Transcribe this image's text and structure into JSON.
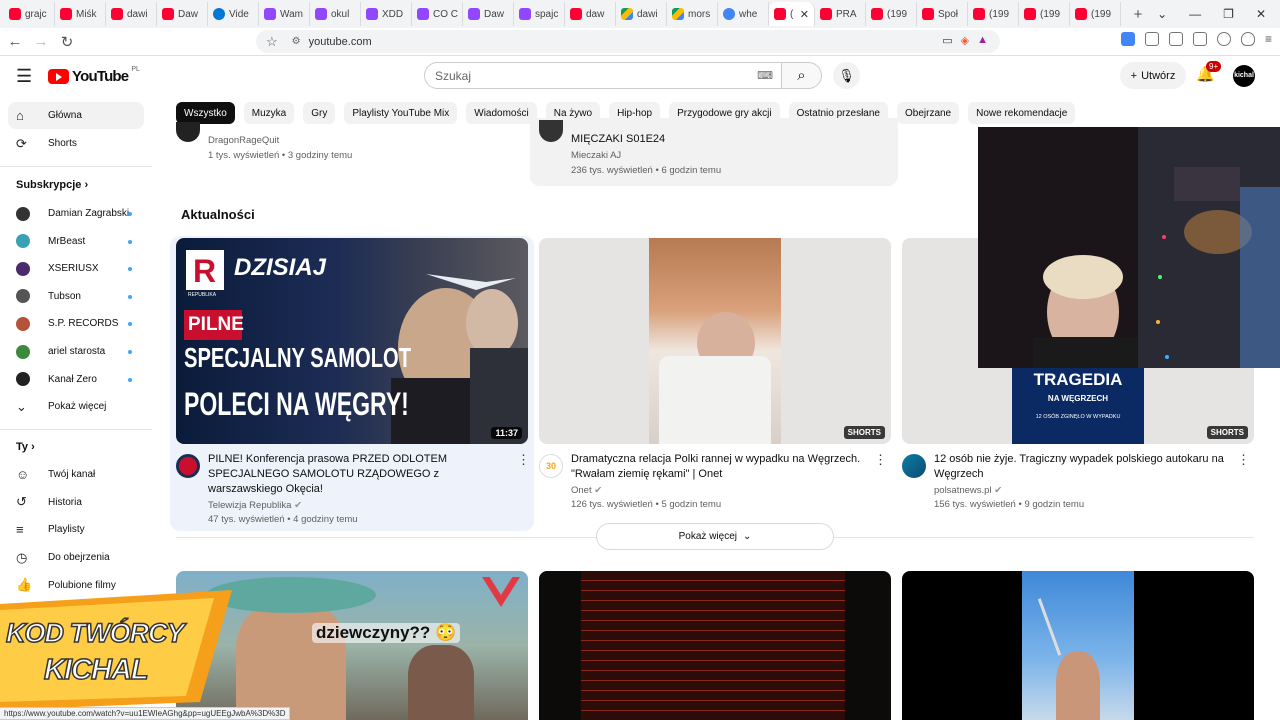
{
  "browser": {
    "tabs": [
      {
        "label": "grajc",
        "icon": "yt"
      },
      {
        "label": "Miśk",
        "icon": "yt"
      },
      {
        "label": "dawi",
        "icon": "yt"
      },
      {
        "label": "Daw",
        "icon": "yt"
      },
      {
        "label": "Vide",
        "icon": "ms"
      },
      {
        "label": "Wam",
        "icon": "tw"
      },
      {
        "label": "okul",
        "icon": "tw"
      },
      {
        "label": "XDD",
        "icon": "tw"
      },
      {
        "label": "CO C",
        "icon": "tw"
      },
      {
        "label": "Daw",
        "icon": "tw"
      },
      {
        "label": "spajc",
        "icon": "tw"
      },
      {
        "label": "daw",
        "icon": "yt"
      },
      {
        "label": "dawi",
        "icon": "gd"
      },
      {
        "label": "mors",
        "icon": "gd"
      },
      {
        "label": "whe",
        "icon": "go"
      },
      {
        "label": "(",
        "icon": "yt",
        "active": true
      },
      {
        "label": "PRA",
        "icon": "yt"
      },
      {
        "label": "(199",
        "icon": "yt"
      },
      {
        "label": "Społ",
        "icon": "yt"
      },
      {
        "label": "(199",
        "icon": "yt"
      },
      {
        "label": "(199",
        "icon": "yt"
      },
      {
        "label": "(199",
        "icon": "yt"
      }
    ],
    "url": "youtube.com",
    "status_url": "https://www.youtube.com/watch?v=uu1EWIeAGhg&pp=ugUEEgJwbA%3D%3D"
  },
  "header": {
    "logo_text": "YouTube",
    "logo_country": "PL",
    "search_placeholder": "Szukaj",
    "create_label": "Utwórz",
    "notif_badge": "9+",
    "avatar_text": "kichal"
  },
  "sidebar": {
    "main": [
      {
        "label": "Główna",
        "icon": "⌂",
        "name": "home"
      },
      {
        "label": "Shorts",
        "icon": "⟳",
        "name": "shorts"
      }
    ],
    "subs_heading": "Subskrypcje",
    "subs": [
      {
        "label": "Damian Zagrabski",
        "color": "#333"
      },
      {
        "label": "MrBeast",
        "color": "#3aa0b5"
      },
      {
        "label": "XSERIUSX",
        "color": "#4b2a6b"
      },
      {
        "label": "Tubson",
        "color": "#555"
      },
      {
        "label": "S.P. RECORDS",
        "color": "#b5523a"
      },
      {
        "label": "ariel starosta",
        "color": "#3a8a3a"
      },
      {
        "label": "Kanał Zero",
        "color": "#222"
      }
    ],
    "show_more": "Pokaż więcej",
    "you_heading": "Ty",
    "you": [
      {
        "label": "Twój kanał",
        "icon": "☺",
        "name": "your-channel"
      },
      {
        "label": "Historia",
        "icon": "↺",
        "name": "history"
      },
      {
        "label": "Playlisty",
        "icon": "≡",
        "name": "playlists"
      },
      {
        "label": "Do obejrzenia",
        "icon": "◷",
        "name": "watch-later"
      },
      {
        "label": "Polubione filmy",
        "icon": "👍",
        "name": "liked"
      }
    ]
  },
  "chips": [
    "Wszystko",
    "Muzyka",
    "Gry",
    "Playlisty YouTube Mix",
    "Wiadomości",
    "Na żywo",
    "Hip-hop",
    "Przygodowe gry akcji",
    "Ostatnio przesłane",
    "Obejrzane",
    "Nowe rekomendacje"
  ],
  "prev_row": {
    "left": {
      "channel": "DragonRageQuit",
      "stats": "1 tys. wyświetleń • 3 godziny temu"
    },
    "middle": {
      "title": "MIĘCZAKI S01E24",
      "channel": "Mieczaki AJ",
      "stats": "236 tys. wyświetleń • 6 godzin temu"
    }
  },
  "section_title": "Aktualności",
  "news": [
    {
      "title": "PILNE! Konferencja prasowa PRZED ODLOTEM SPECJALNEGO SAMOLOTU RZĄDOWEGO z warszawskiego Okęcia!",
      "channel": "Telewizja Republika",
      "stats": "47 tys. wyświetleń • 4 godziny temu",
      "duration": "11:37",
      "thumb_text": {
        "badge": "DZISIAJ",
        "pilne": "PILNE",
        "line1": "SPECJALNY SAMOLOT",
        "line2": "POLECI NA WĘGRY!",
        "brand": "REPUBLIKA"
      }
    },
    {
      "title": "Dramatyczna relacja Polki rannej w wypadku na Węgrzech. \"Rwałam ziemię rękami\" | Onet",
      "channel": "Onet",
      "stats": "126 tys. wyświetleń • 5 godzin temu",
      "badge": "SHORTS"
    },
    {
      "title": "12 osób nie żyje. Tragiczny wypadek polskiego autokaru na Węgrzech",
      "channel": "polsatnews.pl",
      "stats": "156 tys. wyświetleń • 9 godzin temu",
      "badge": "SHORTS",
      "thumb_text": {
        "line1": "TRAGEDIA",
        "line2": "NA WĘGRZECH",
        "line3": "12 OSÓB ZGINĘŁO W WYPADKU"
      }
    }
  ],
  "show_more_label": "Pokaż więcej",
  "row2": {
    "thumb1_text": "dziewczyny?? 😳"
  },
  "overlay": {
    "line1": "KOD TWÓRCY",
    "line2": "KICHAL"
  }
}
